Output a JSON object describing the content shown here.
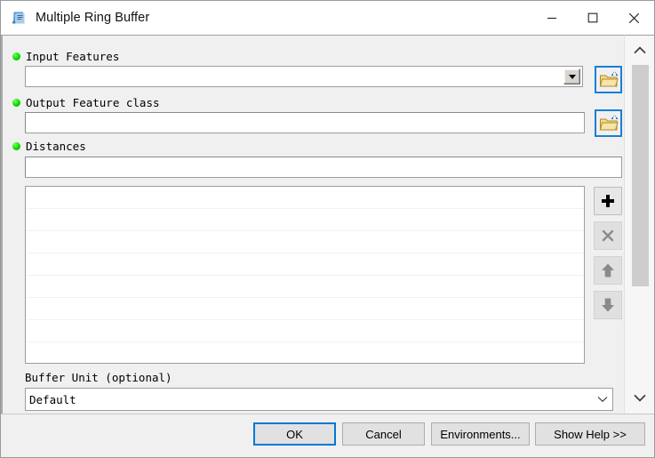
{
  "window": {
    "title": "Multiple Ring Buffer",
    "icon": "script-tool-icon",
    "controls": {
      "minimize": "minimize-icon",
      "maximize": "maximize-icon",
      "close": "close-icon"
    }
  },
  "form": {
    "input_features": {
      "label": "Input Features",
      "required": true,
      "value": "",
      "placeholder": "",
      "browse_label": "open-folder-icon"
    },
    "output_feature_class": {
      "label": "Output Feature class",
      "required": true,
      "value": "",
      "placeholder": "",
      "browse_label": "open-folder-icon"
    },
    "distances": {
      "label": "Distances",
      "required": true,
      "value": "",
      "placeholder": "",
      "items": []
    },
    "buffer_unit": {
      "label": "Buffer Unit (optional)",
      "required": false,
      "value": "Default"
    }
  },
  "list_tools": {
    "add": "+",
    "remove": "×",
    "move_up": "↑",
    "move_down": "↓"
  },
  "footer": {
    "ok": "OK",
    "cancel": "Cancel",
    "environments": "Environments...",
    "show_help": "Show Help >>"
  },
  "scrollbar": {
    "up": "chevron-up-icon",
    "down": "chevron-down-icon"
  },
  "colors": {
    "required_dot": "#11e000",
    "accent": "#0078d7",
    "browse_border": "#1a7fd4",
    "panel_bg": "#f0f0f0"
  }
}
